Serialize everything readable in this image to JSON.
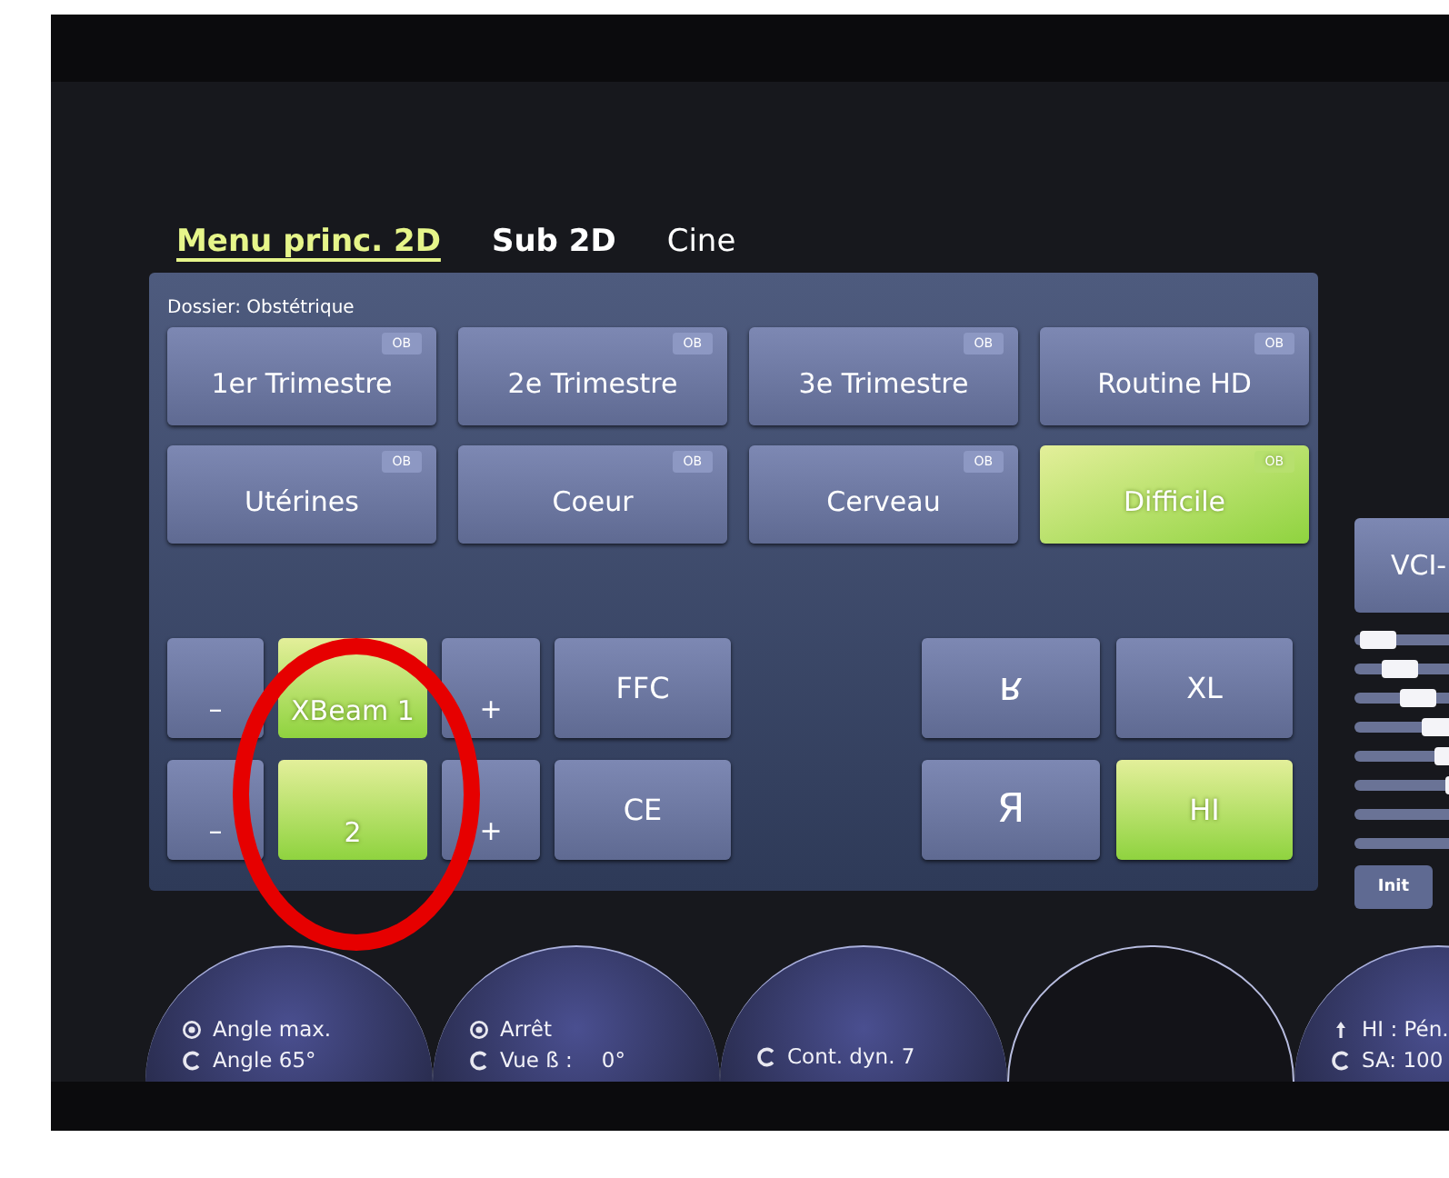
{
  "tabs": [
    {
      "label": "Menu princ. 2D",
      "selected": true
    },
    {
      "label": "Sub 2D",
      "selected": false
    },
    {
      "label": "Cine",
      "selected": false
    }
  ],
  "panel": {
    "folder": "Dossier: Obstétrique",
    "presets": [
      {
        "label": "1er Trimestre",
        "badge": "OB",
        "selected": false
      },
      {
        "label": "2e Trimestre",
        "badge": "OB",
        "selected": false
      },
      {
        "label": "3e Trimestre",
        "badge": "OB",
        "selected": false
      },
      {
        "label": "Routine HD",
        "badge": "OB",
        "selected": false
      },
      {
        "label": "Utérines",
        "badge": "OB",
        "selected": false
      },
      {
        "label": "Coeur",
        "badge": "OB",
        "selected": false
      },
      {
        "label": "Cerveau",
        "badge": "OB",
        "selected": false
      },
      {
        "label": "Difficile",
        "badge": "OB",
        "selected": true
      }
    ],
    "params": [
      {
        "minus": "–",
        "value": "XBeam 1",
        "plus": "+",
        "selected": true,
        "side": {
          "label": "FFC",
          "selected": false
        }
      },
      {
        "minus": "–",
        "value": "2",
        "plus": "+",
        "selected": true,
        "side": {
          "label": "CE",
          "selected": false
        }
      }
    ],
    "orientation_buttons": [
      {
        "label": "ʁ",
        "selected": false
      },
      {
        "label": "XL",
        "selected": false
      },
      {
        "label": "Я",
        "selected": false
      },
      {
        "label": "HI",
        "selected": true
      }
    ]
  },
  "side": {
    "top_button": "VCI-",
    "tgc_sliders": [
      {
        "kind": "slider",
        "level": 0.12
      },
      {
        "kind": "slider",
        "level": 0.25
      },
      {
        "kind": "slider",
        "level": 0.37
      },
      {
        "kind": "slider",
        "level": 0.5
      },
      {
        "kind": "slider",
        "level": 0.58
      },
      {
        "kind": "slider",
        "level": 0.64
      },
      {
        "kind": "track"
      },
      {
        "kind": "track"
      }
    ],
    "reset_button": "Init"
  },
  "knobs": [
    {
      "kind": "filled",
      "lines": [
        {
          "kind": "press",
          "text": "Angle max."
        },
        {
          "kind": "rotate",
          "text": "Angle 65°"
        }
      ]
    },
    {
      "kind": "filled",
      "lines": [
        {
          "kind": "press",
          "text": "Arrêt"
        },
        {
          "kind": "rotate",
          "text": "Vue ß :",
          "value": "0°"
        }
      ]
    },
    {
      "kind": "filled",
      "lines": [
        {
          "kind": "rotate",
          "text": "Cont. dyn. 7"
        }
      ]
    },
    {
      "kind": "empty"
    },
    {
      "kind": "filled",
      "lines": [
        {
          "kind": "up",
          "text": "HI : Pén."
        },
        {
          "kind": "rotate",
          "text": "SA: 100"
        }
      ]
    }
  ],
  "annotation": {
    "kind": "ellipse"
  }
}
